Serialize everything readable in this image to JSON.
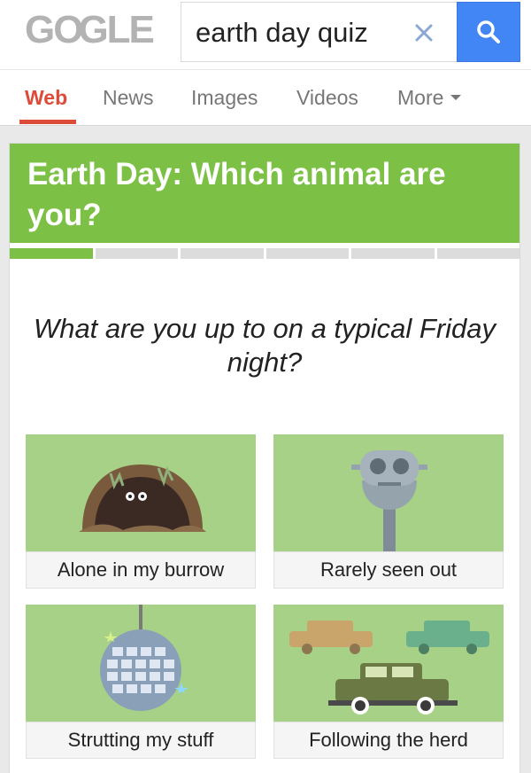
{
  "header": {
    "logo_text_left": "GO",
    "logo_text_right": "GLE",
    "search": {
      "value": "earth day quiz",
      "placeholder": ""
    },
    "icons": {
      "clear": "close-icon",
      "search": "search-icon"
    },
    "accent_color": "#4285f4"
  },
  "tabs": [
    {
      "label": "Web",
      "active": true
    },
    {
      "label": "News",
      "active": false
    },
    {
      "label": "Images",
      "active": false
    },
    {
      "label": "Videos",
      "active": false
    },
    {
      "label": "More",
      "active": false
    }
  ],
  "quiz": {
    "title": "Earth Day: Which animal are you?",
    "progress": {
      "total_steps": 6,
      "current_step": 1
    },
    "question": "What are you up to on a typical Friday night?",
    "options": [
      {
        "label": "Alone in my burrow",
        "icon": "burrow-icon"
      },
      {
        "label": "Rarely seen out",
        "icon": "binoculars-icon"
      },
      {
        "label": "Strutting my stuff",
        "icon": "disco-ball-icon"
      },
      {
        "label": "Following the herd",
        "icon": "cars-icon"
      }
    ],
    "colors": {
      "header_green": "#7cc045",
      "option_green": "#a7d186"
    }
  }
}
